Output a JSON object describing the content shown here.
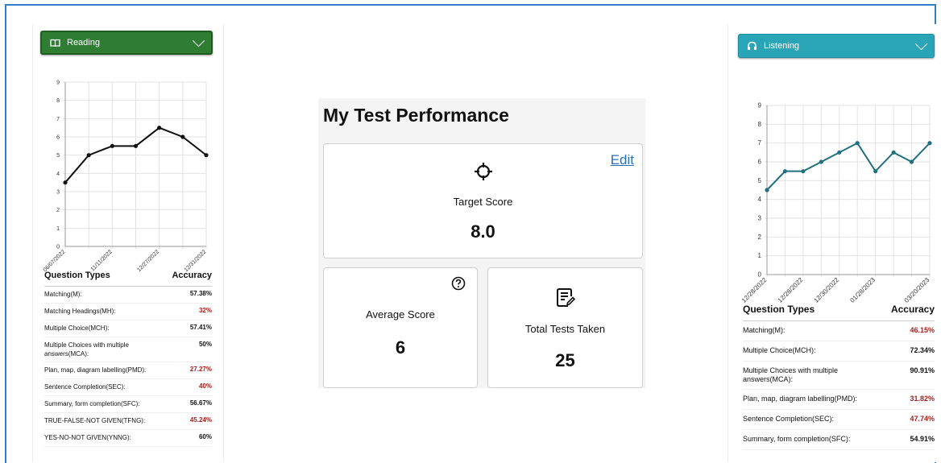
{
  "reading": {
    "dropdown_label": "Reading",
    "accent": "#2e7d32",
    "chart_data": {
      "type": "line",
      "x": [
        "06/07/2022",
        "",
        "11/11/2022",
        "",
        "12/27/2022",
        "",
        "12/31/2022"
      ],
      "y": [
        3.5,
        5,
        5.5,
        5.5,
        6.5,
        6,
        5
      ],
      "ylim": [
        0,
        9
      ],
      "yticks": [
        "0",
        "1",
        "2",
        "3",
        "4",
        "5",
        "6",
        "7",
        "8",
        "9"
      ],
      "xticklabels": [
        "06/07/2022",
        "11/11/2022",
        "12/27/2022",
        "12/31/2022"
      ],
      "grid": true
    },
    "table": {
      "col1": "Question Types",
      "col2": "Accuracy",
      "rows": [
        {
          "name": "Matching(M):",
          "value": "57.38%",
          "status": "good"
        },
        {
          "name": "Matching Headings(MH):",
          "value": "32%",
          "status": "bad"
        },
        {
          "name": "Multiple Choice(MCH):",
          "value": "57.41%",
          "status": "good"
        },
        {
          "name": "Multiple Choices with multiple answers(MCA):",
          "value": "50%",
          "status": "good"
        },
        {
          "name": "Plan, map, diagram labelling(PMD):",
          "value": "27.27%",
          "status": "bad"
        },
        {
          "name": "Sentence Completion(SEC):",
          "value": "40%",
          "status": "bad"
        },
        {
          "name": "Summary, form completion(SFC):",
          "value": "56.67%",
          "status": "good"
        },
        {
          "name": "TRUE-FALSE-NOT GIVEN(TFNG):",
          "value": "45.24%",
          "status": "bad"
        },
        {
          "name": "YES-NO-NOT GIVEN(YNNG):",
          "value": "60%",
          "status": "good"
        }
      ]
    }
  },
  "listening": {
    "dropdown_label": "Listening",
    "accent": "#1f7080",
    "chart_data": {
      "type": "line",
      "x": [
        "12/28/2022",
        "",
        "12/28/2022",
        "",
        "12/30/2022",
        "",
        "01/28/2023",
        "",
        "",
        "03/20/2023"
      ],
      "y": [
        4.5,
        5.5,
        5.5,
        6,
        6.5,
        7,
        5.5,
        6.5,
        6,
        7
      ],
      "ylim": [
        0,
        9
      ],
      "yticks": [
        "0",
        "1",
        "2",
        "3",
        "4",
        "5",
        "6",
        "7",
        "8",
        "9"
      ],
      "xticklabels": [
        "12/28/2022",
        "12/28/2022",
        "12/30/2022",
        "01/28/2023",
        "03/20/2023"
      ],
      "grid": true
    },
    "table": {
      "col1": "Question Types",
      "col2": "Accuracy",
      "rows": [
        {
          "name": "Matching(M):",
          "value": "46.15%",
          "status": "bad"
        },
        {
          "name": "Multiple Choice(MCH):",
          "value": "72.34%",
          "status": "good"
        },
        {
          "name": "Multiple Choices with multiple answers(MCA):",
          "value": "90.91%",
          "status": "good"
        },
        {
          "name": "Plan, map, diagram labelling(PMD):",
          "value": "31.82%",
          "status": "bad"
        },
        {
          "name": "Sentence Completion(SEC):",
          "value": "47.74%",
          "status": "bad"
        },
        {
          "name": "Summary, form completion(SFC):",
          "value": "54.91%",
          "status": "good"
        }
      ]
    }
  },
  "performance": {
    "title": "My Test Performance",
    "target_label": "Target Score",
    "target_value": "8.0",
    "edit_label": "Edit",
    "average_label": "Average Score",
    "average_value": "6",
    "tests_label": "Total Tests Taken",
    "tests_value": "25"
  },
  "icons": {
    "reading": "book-icon",
    "listening": "headphones-icon",
    "target": "crosshair-icon",
    "help": "question-circle-icon",
    "tests": "document-edit-icon"
  }
}
